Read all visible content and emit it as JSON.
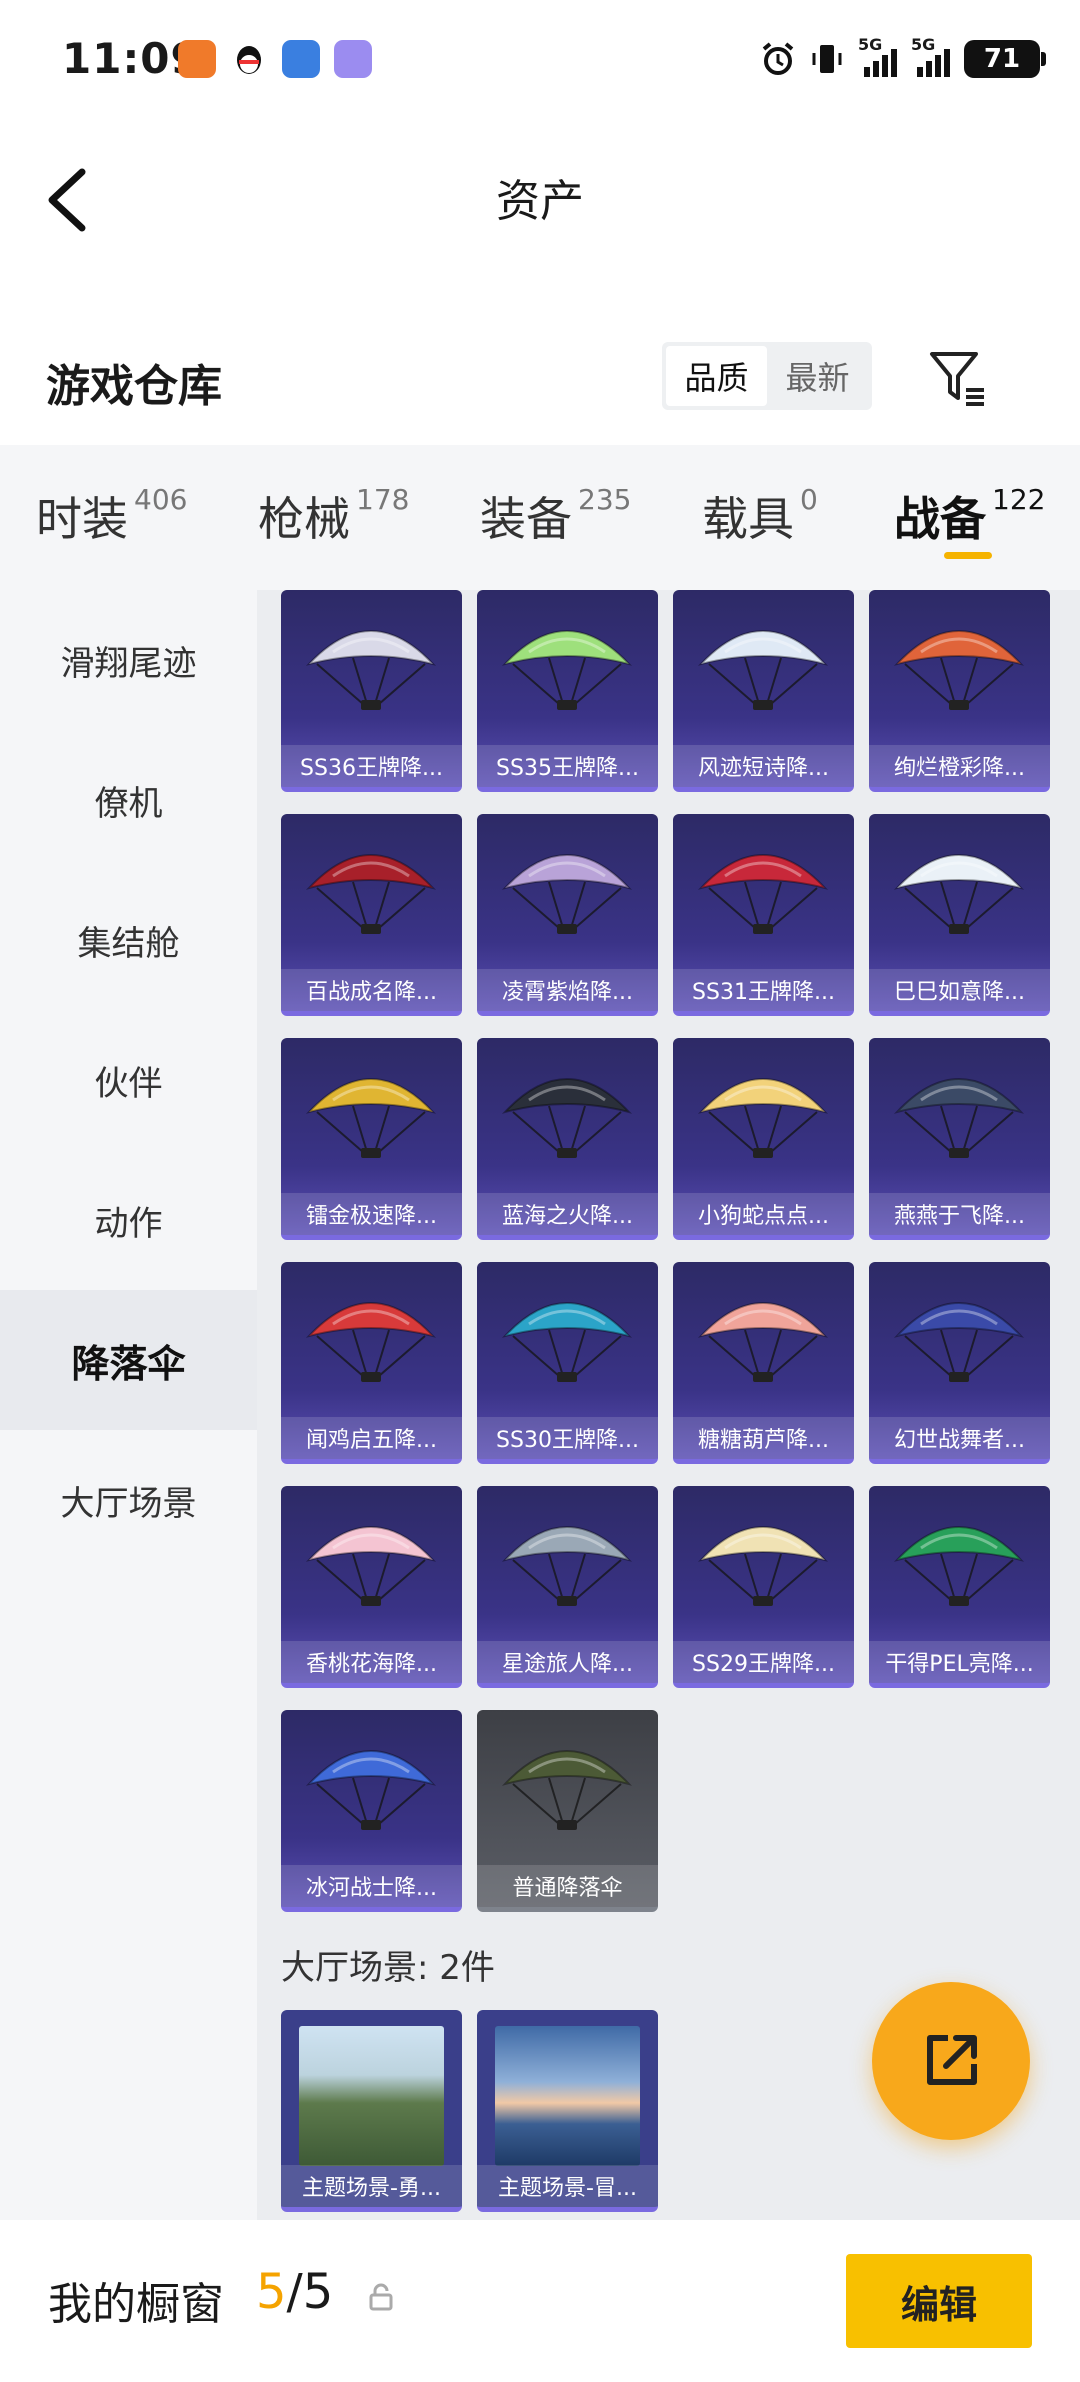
{
  "status_bar": {
    "time": "11:09",
    "battery": "71",
    "network": "5G"
  },
  "header": {
    "title": "资产"
  },
  "warehouse": {
    "title": "游戏仓库",
    "sort": [
      "品质",
      "最新"
    ],
    "active_sort": "品质"
  },
  "tabs": [
    {
      "label": "时装",
      "count": "406"
    },
    {
      "label": "枪械",
      "count": "178"
    },
    {
      "label": "装备",
      "count": "235"
    },
    {
      "label": "载具",
      "count": "0"
    },
    {
      "label": "战备",
      "count": "122",
      "active": true
    }
  ],
  "sidebar": [
    {
      "label": "滑翔尾迹"
    },
    {
      "label": "僚机"
    },
    {
      "label": "集结舱"
    },
    {
      "label": "伙伴"
    },
    {
      "label": "动作"
    },
    {
      "label": "降落伞",
      "active": true
    },
    {
      "label": "大厅场景"
    }
  ],
  "parachutes": [
    {
      "name": "SS36王牌降...",
      "color": "#d9d9e8"
    },
    {
      "name": "SS35王牌降...",
      "color": "#9ee07c"
    },
    {
      "name": "风迹短诗降...",
      "color": "#dfe9f5"
    },
    {
      "name": "绚烂橙彩降...",
      "color": "#e0643a"
    },
    {
      "name": "百战成名降...",
      "color": "#a8202a"
    },
    {
      "name": "凌霄紫焰降...",
      "color": "#b9a3d8"
    },
    {
      "name": "SS31王牌降...",
      "color": "#c8283a"
    },
    {
      "name": "巳巳如意降...",
      "color": "#eaf1f7"
    },
    {
      "name": "镭金极速降...",
      "color": "#e0b532"
    },
    {
      "name": "蓝海之火降...",
      "color": "#2a2f3a"
    },
    {
      "name": "小狗蛇点点...",
      "color": "#f2d27a"
    },
    {
      "name": "燕燕于飞降...",
      "color": "#3b4a66"
    },
    {
      "name": "闻鸡启五降...",
      "color": "#d83a3a"
    },
    {
      "name": "SS30王牌降...",
      "color": "#2ba4c8"
    },
    {
      "name": "糖糖葫芦降...",
      "color": "#f0a49a"
    },
    {
      "name": "幻世战舞者...",
      "color": "#3a4aa8"
    },
    {
      "name": "香桃花海降...",
      "color": "#f4c4d2"
    },
    {
      "name": "星途旅人降...",
      "color": "#9aa8b6"
    },
    {
      "name": "SS29王牌降...",
      "color": "#f0e2b4"
    },
    {
      "name": "干得PEL亮降...",
      "color": "#28a05a"
    },
    {
      "name": "冰河战士降...",
      "color": "#3f6ad8"
    },
    {
      "name": "普通降落伞",
      "color": "#4c5a36",
      "normal": true
    }
  ],
  "scene_section": {
    "label": "大厅场景: 2件"
  },
  "scenes": [
    {
      "name": "主题场景-勇..."
    },
    {
      "name": "主题场景-冒..."
    }
  ],
  "bottom_bar": {
    "label": "我的橱窗",
    "current": "5",
    "total": "/5",
    "edit": "编辑"
  }
}
